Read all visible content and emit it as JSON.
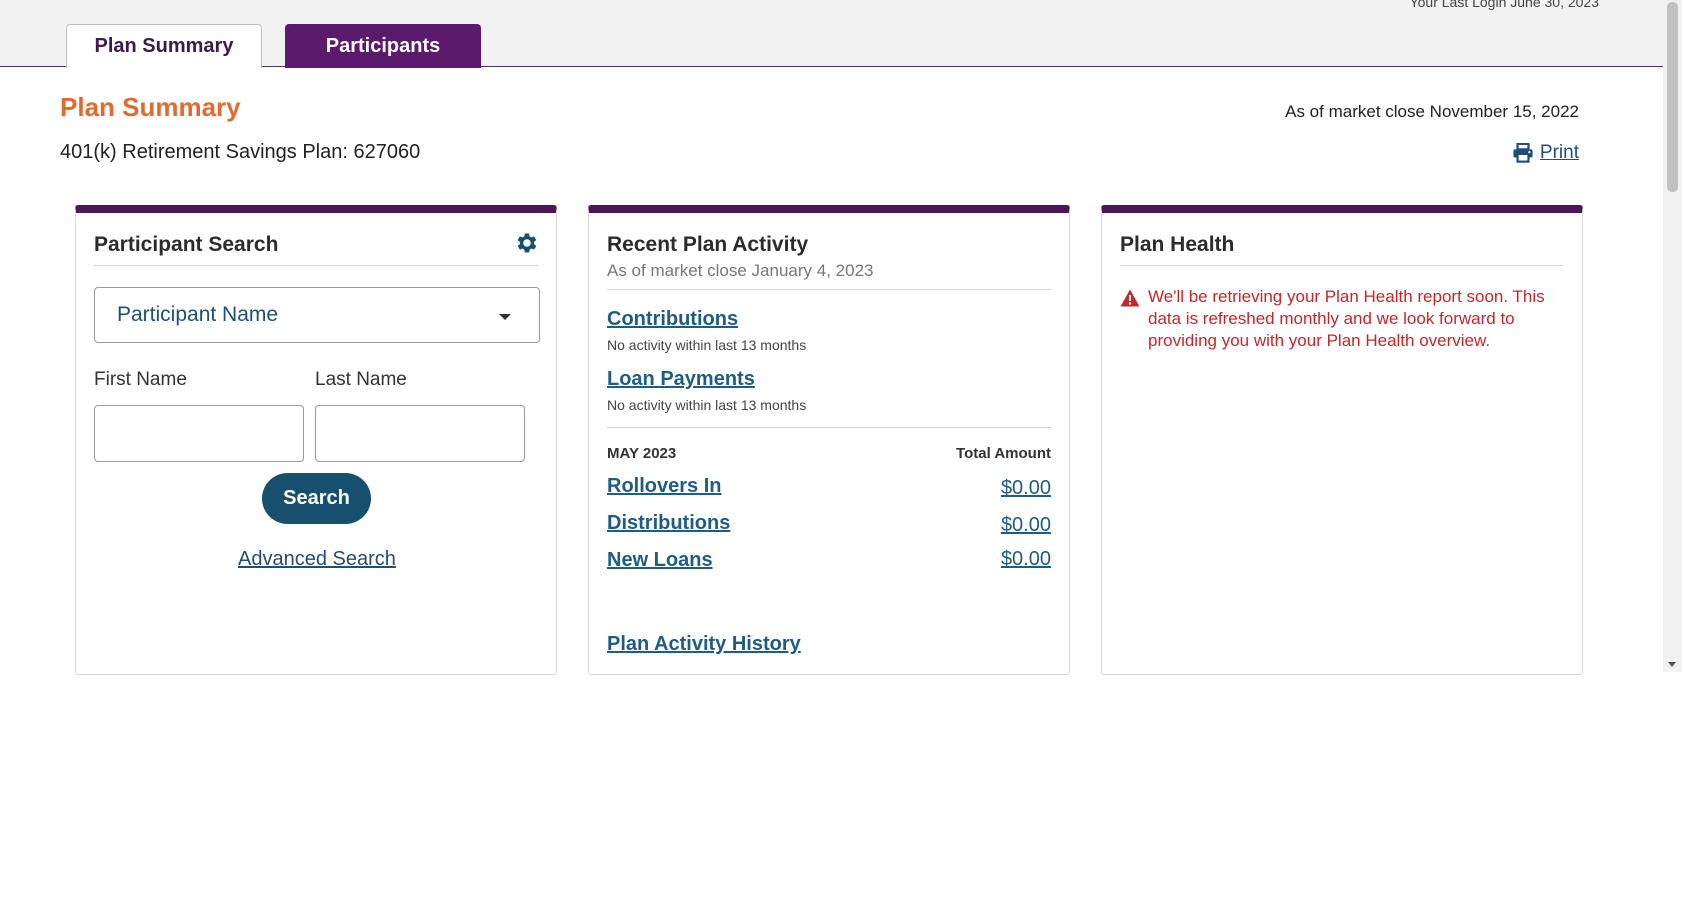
{
  "header": {
    "last_login": "Your Last Login June 30, 2023",
    "tabs": [
      {
        "label": "Plan Summary",
        "active": true
      },
      {
        "label": "Participants",
        "active": false
      }
    ]
  },
  "page": {
    "title": "Plan Summary",
    "as_of": "As of market close November 15, 2022",
    "plan_name": "401(k) Retirement Savings Plan: 627060",
    "print_label": "Print",
    "print_icon": "printer-icon"
  },
  "participant_search": {
    "title": "Participant Search",
    "settings_icon": "gear-icon",
    "select_value": "Participant Name",
    "first_name_label": "First Name",
    "last_name_label": "Last Name",
    "first_name_value": "",
    "last_name_value": "",
    "search_button": "Search",
    "advanced_search": "Advanced Search"
  },
  "recent_activity": {
    "title": "Recent Plan Activity",
    "as_of": "As of market close January 4, 2023",
    "items": [
      {
        "label": "Contributions",
        "note": "No activity within last 13 months"
      },
      {
        "label": "Loan Payments",
        "note": "No activity within last 13 months"
      }
    ],
    "month_label": "MAY 2023",
    "total_label": "Total Amount",
    "rows": [
      {
        "label": "Rollovers In",
        "amount": "$0.00"
      },
      {
        "label": "Distributions",
        "amount": "$0.00"
      },
      {
        "label": "New Loans",
        "amount": "$0.00"
      }
    ],
    "history_link": "Plan Activity History"
  },
  "plan_health": {
    "title": "Plan Health",
    "alert_icon": "warning-icon",
    "message": "We'll be retrieving your Plan Health report soon. This data is refreshed monthly and we look forward to providing you with your Plan Health overview."
  },
  "colors": {
    "brand_purple": "#4b1557",
    "accent_orange": "#e06a2f",
    "link_blue": "#1f5c85",
    "button_blue": "#17506f",
    "alert_red": "#c0282d"
  }
}
